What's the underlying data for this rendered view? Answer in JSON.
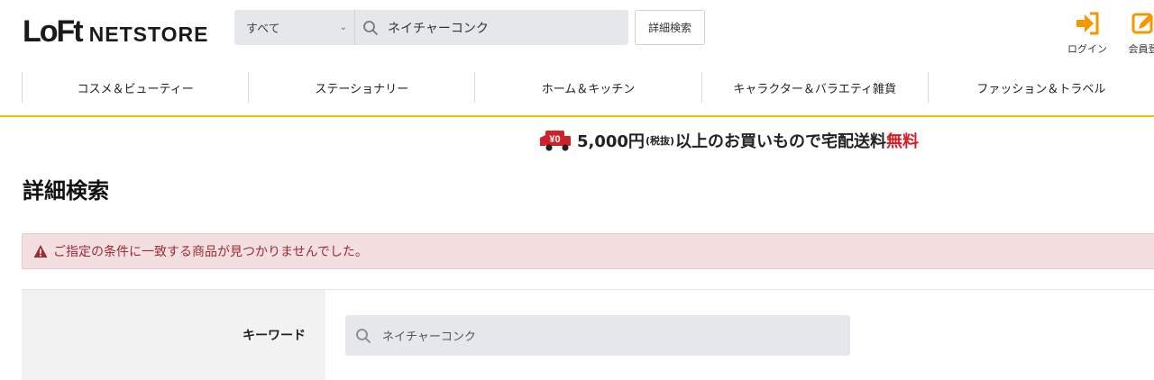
{
  "header": {
    "logo_mark": "LoFt",
    "logo_text": "NETSTORE",
    "search": {
      "category": "すべて",
      "query": "ネイチャーコンク"
    },
    "advanced_search_label": "詳細検索",
    "login_label": "ログイン",
    "register_label": "会員登",
    "accent_color": "#f39800"
  },
  "nav": {
    "items": [
      "コスメ＆ビューティー",
      "ステーショナリー",
      "ホーム＆キッチン",
      "キャラクター＆バラエティ雑貨",
      "ファッション＆トラベル"
    ]
  },
  "shipping": {
    "badge": "¥0",
    "amount": "5,000円",
    "tax_note": "(税抜)",
    "condition": "以上のお買いもので宅配送料",
    "free": "無料"
  },
  "page": {
    "title": "詳細検索"
  },
  "alert": {
    "message": "ご指定の条件に一致する商品が見つかりませんでした。"
  },
  "form": {
    "keyword_label": "キーワード",
    "keyword_value": "ネイチャーコンク"
  }
}
